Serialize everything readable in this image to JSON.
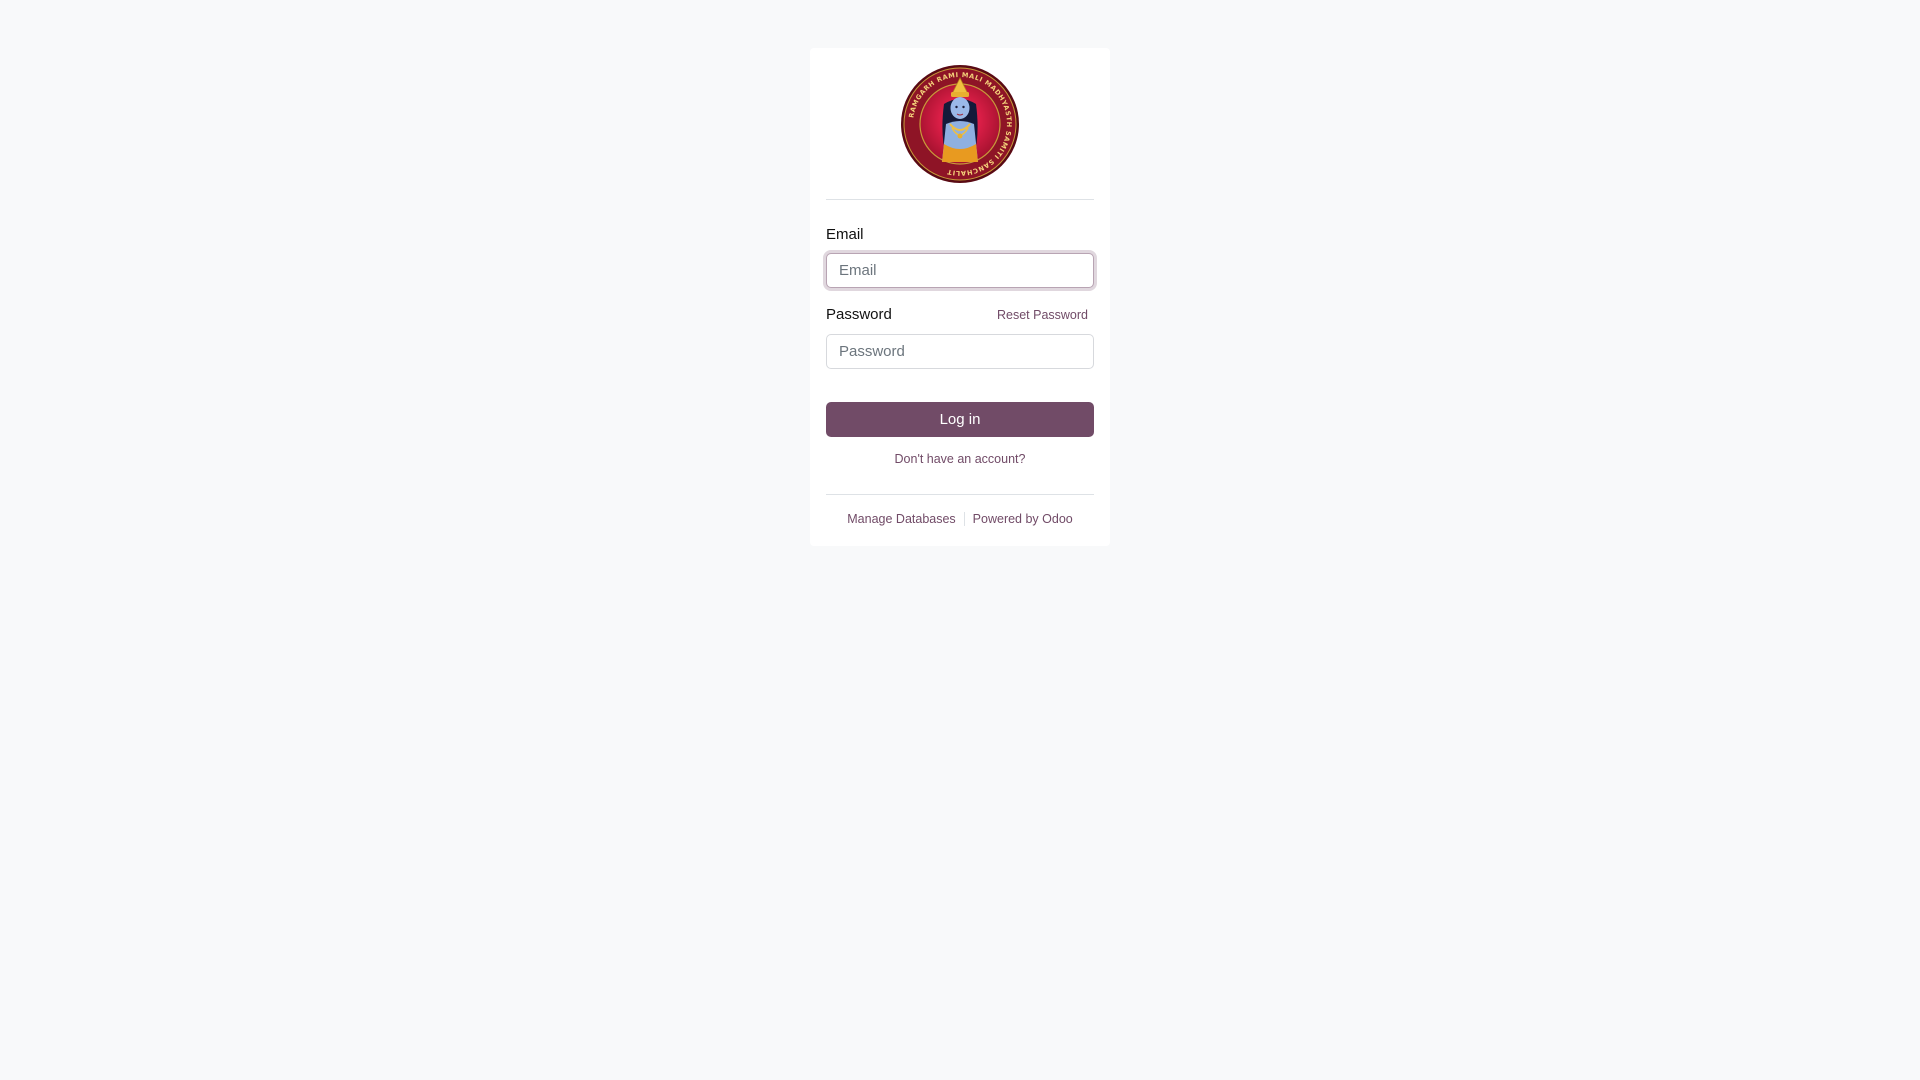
{
  "logo": {
    "seal_text": "RAMGARH RAMI MALI MADHYASTH SAMITI SANCHALIT",
    "colors": {
      "ring_outer": "#5a0a14",
      "ring_inner": "#8e1426",
      "center": "#c8143c",
      "gold": "#f0c040"
    }
  },
  "form": {
    "email_label": "Email",
    "email_placeholder": "Email",
    "email_value": "",
    "password_label": "Password",
    "password_placeholder": "Password",
    "password_value": "",
    "reset_password": "Reset Password",
    "login_button": "Log in",
    "signup_link": "Don't have an account?"
  },
  "footer": {
    "manage_databases": "Manage Databases",
    "powered_by": "Powered by Odoo"
  },
  "theme": {
    "brand": "#714B67",
    "background": "#f8f9fa",
    "card": "#ffffff"
  }
}
